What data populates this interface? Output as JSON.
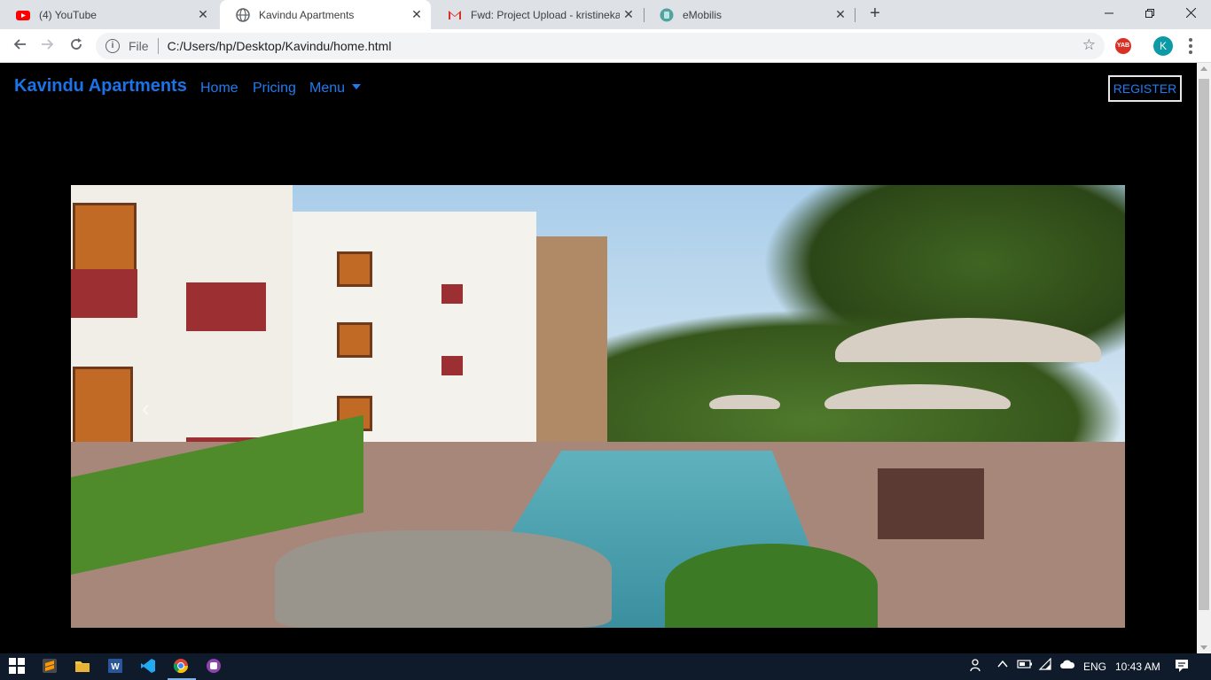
{
  "browser": {
    "tabs": [
      {
        "title": "(4) YouTube",
        "icon": "youtube-icon"
      },
      {
        "title": "Kavindu Apartments",
        "icon": "globe-icon",
        "active": true
      },
      {
        "title": "Fwd: Project Upload - kristinekak",
        "icon": "gmail-icon"
      },
      {
        "title": "eMobilis",
        "icon": "emobilis-icon"
      }
    ],
    "close_glyph": "✕",
    "new_tab_glyph": "+",
    "address": {
      "scheme_label": "File",
      "url": "C:/Users/hp/Desktop/Kavindu/home.html"
    },
    "profile_initial": "K",
    "extension_label": "YAB"
  },
  "page": {
    "brand": "Kavindu Apartments",
    "nav": {
      "home": "Home",
      "pricing": "Pricing",
      "menu": "Menu"
    },
    "register": "REGISTER",
    "carousel": {
      "prev_glyph": "‹"
    }
  },
  "taskbar": {
    "language": "ENG",
    "time": "10:43 AM"
  },
  "colors": {
    "accent": "#1e7cf2",
    "page_bg": "#000000"
  }
}
